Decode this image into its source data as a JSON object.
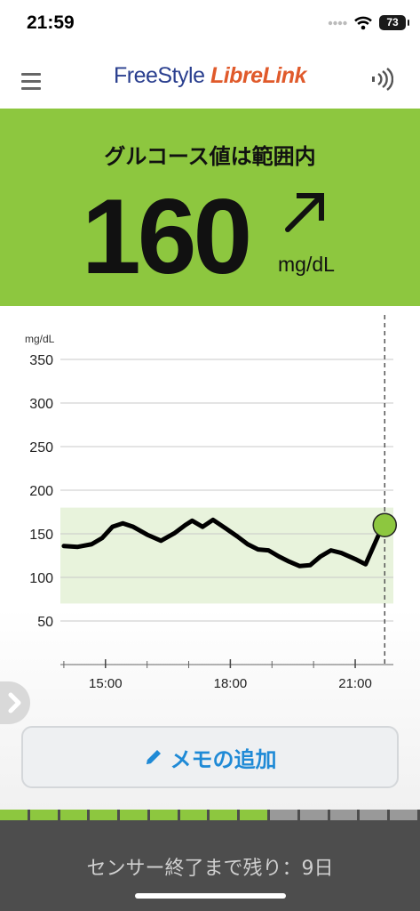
{
  "status_bar": {
    "time": "21:59",
    "battery": "73"
  },
  "header": {
    "logo_part1": "FreeStyle",
    "logo_part2": "LibreLink"
  },
  "glucose": {
    "status_text": "グルコース値は範囲内",
    "value": "160",
    "unit": "mg/dL",
    "trend": "rising-diagonal"
  },
  "chart_data": {
    "type": "line",
    "ylabel": "mg/dL",
    "y_ticks": [
      350,
      300,
      250,
      200,
      150,
      100,
      50
    ],
    "ylim": [
      0,
      350
    ],
    "x_tick_labels": [
      "15:00",
      "18:00",
      "21:00"
    ],
    "target_range": [
      70,
      180
    ],
    "grid": true,
    "series": [
      {
        "x": [
          "14:00",
          "14:20",
          "14:40",
          "14:55",
          "15:10",
          "15:25",
          "15:40",
          "16:00",
          "16:20",
          "16:40",
          "16:55",
          "17:05",
          "17:20",
          "17:35",
          "17:50",
          "18:10",
          "18:25",
          "18:40",
          "18:55",
          "19:10",
          "19:25",
          "19:40",
          "19:55",
          "20:10",
          "20:25",
          "20:40",
          "21:00",
          "21:15",
          "21:40"
        ],
        "values": [
          136,
          135,
          138,
          145,
          158,
          162,
          158,
          149,
          142,
          151,
          160,
          165,
          158,
          166,
          158,
          147,
          138,
          132,
          131,
          124,
          118,
          113,
          114,
          124,
          131,
          128,
          121,
          115,
          160
        ]
      }
    ],
    "current_point": {
      "x": "21:40",
      "value": 160
    }
  },
  "memo_button": {
    "label": "メモの追加"
  },
  "sensor": {
    "remaining_text": "センサー終了まで残り：9日",
    "days_elapsed": 9,
    "days_total": 14
  },
  "colors": {
    "accent_green": "#8dc73f",
    "target_band": "#e8f3dc",
    "memo_blue": "#1f8ad6",
    "footer_gray": "#4d4d4d"
  },
  "icons": [
    "menu-icon",
    "nfc-icon",
    "trend-arrow-icon",
    "pencil-icon",
    "chevron-right-icon",
    "wifi-icon",
    "signal-icon",
    "battery-icon"
  ]
}
